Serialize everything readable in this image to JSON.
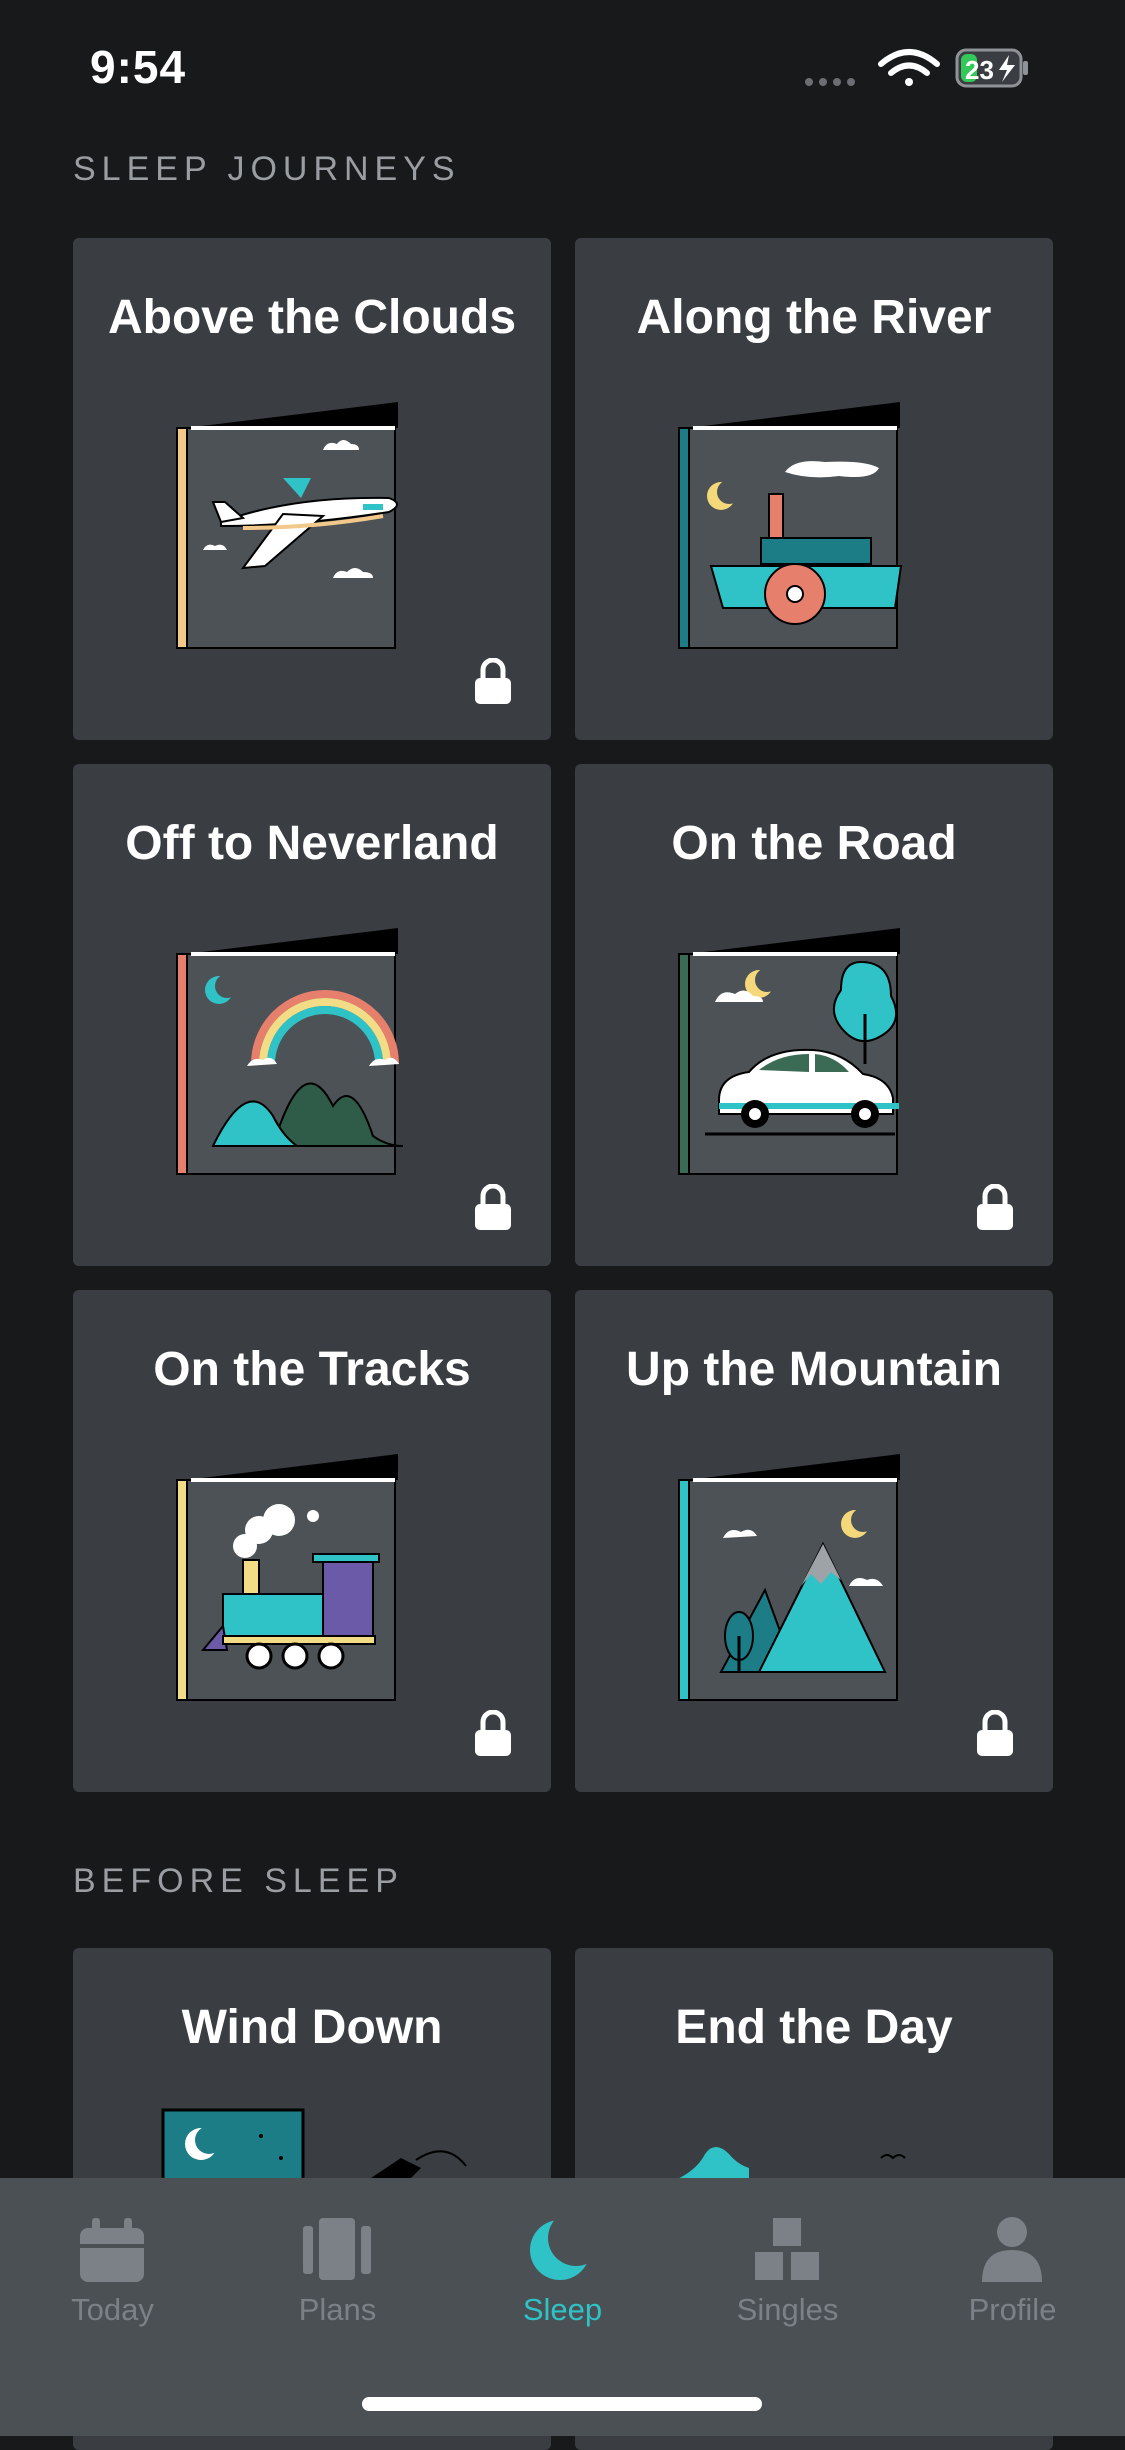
{
  "status_bar": {
    "time": "9:54",
    "battery": "23"
  },
  "sections": {
    "sleep_journeys": "SLEEP JOURNEYS",
    "before_sleep": "BEFORE SLEEP"
  },
  "journeys": [
    {
      "title": "Above the Clouds",
      "locked": true,
      "accent": "#f3c98b"
    },
    {
      "title": "Along the River",
      "locked": false,
      "accent": "#1d7d86"
    },
    {
      "title": "Off to Neverland",
      "locked": true,
      "accent": "#e77f6d"
    },
    {
      "title": "On the Road",
      "locked": true,
      "accent": "#3c6b55"
    },
    {
      "title": "On the Tracks",
      "locked": true,
      "accent": "#f2dc85"
    },
    {
      "title": "Up the Mountain",
      "locked": true,
      "accent": "#2fc3c8"
    }
  ],
  "before_sleep": [
    {
      "title": "Wind Down"
    },
    {
      "title": "End the Day"
    }
  ],
  "tabs": [
    {
      "label": "Today",
      "icon": "calendar-icon",
      "active": false
    },
    {
      "label": "Plans",
      "icon": "plans-icon",
      "active": false
    },
    {
      "label": "Sleep",
      "icon": "moon-icon",
      "active": true
    },
    {
      "label": "Singles",
      "icon": "singles-icon",
      "active": false
    },
    {
      "label": "Profile",
      "icon": "profile-icon",
      "active": false
    }
  ],
  "colors": {
    "accent": "#2fc3c8",
    "background": "#17191b",
    "card": "#3a3e42",
    "tabbar": "#4b5055"
  }
}
